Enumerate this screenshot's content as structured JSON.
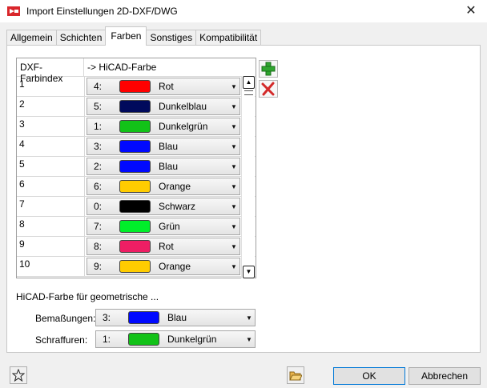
{
  "window": {
    "title": "Import Einstellungen 2D-DXF/DWG",
    "close": "✕"
  },
  "tabs": [
    {
      "label": "Allgemein"
    },
    {
      "label": "Schichten"
    },
    {
      "label": "Farben"
    },
    {
      "label": "Sonstiges"
    },
    {
      "label": "Kompatibilität"
    }
  ],
  "grid": {
    "headers": [
      "DXF-Farbindex",
      "-> HiCAD-Farbe"
    ],
    "rows": [
      {
        "index": "1",
        "num": "4:",
        "color": "#ff0000",
        "name": "Rot"
      },
      {
        "index": "2",
        "num": "5:",
        "color": "#000a5c",
        "name": "Dunkelblau"
      },
      {
        "index": "3",
        "num": "1:",
        "color": "#12c218",
        "name": "Dunkelgrün"
      },
      {
        "index": "4",
        "num": "3:",
        "color": "#0009ff",
        "name": "Blau"
      },
      {
        "index": "5",
        "num": "2:",
        "color": "#0009ff",
        "name": "Blau"
      },
      {
        "index": "6",
        "num": "6:",
        "color": "#ffcc00",
        "name": "Orange"
      },
      {
        "index": "7",
        "num": "0:",
        "color": "#000000",
        "name": "Schwarz"
      },
      {
        "index": "8",
        "num": "7:",
        "color": "#00ee2a",
        "name": "Grün"
      },
      {
        "index": "9",
        "num": "8:",
        "color": "#ee1e64",
        "name": "Rot"
      },
      {
        "index": "10",
        "num": "9:",
        "color": "#ffcc00",
        "name": "Orange"
      }
    ]
  },
  "geometric": {
    "heading": "HiCAD-Farbe für geometrische ...",
    "dimensions": {
      "label": "Bemaßungen:",
      "num": "3:",
      "color": "#0009ff",
      "name": "Blau"
    },
    "hatching": {
      "label": "Schraffuren:",
      "num": "1:",
      "color": "#12c218",
      "name": "Dunkelgrün"
    }
  },
  "buttons": {
    "ok": "OK",
    "cancel": "Abbrechen"
  },
  "icons": {
    "add": "plus-icon",
    "delete": "delete-x-icon",
    "favorite": "star-icon",
    "folder": "folder-icon"
  }
}
